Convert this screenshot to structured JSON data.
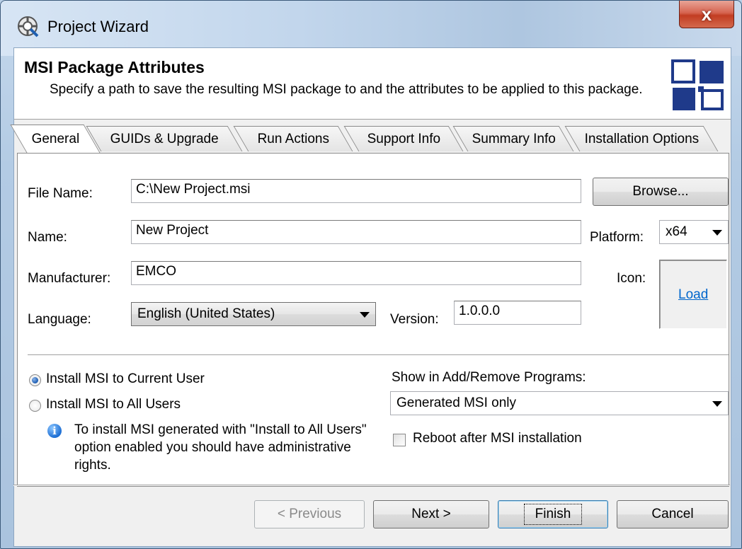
{
  "window": {
    "title": "Project Wizard",
    "close_label": "x"
  },
  "header": {
    "title": "MSI Package Attributes",
    "description": "Specify a path to save the resulting MSI package to and the attributes to be applied to this package."
  },
  "tabs": [
    {
      "label": "General",
      "active": true
    },
    {
      "label": "GUIDs & Upgrade",
      "active": false
    },
    {
      "label": "Run Actions",
      "active": false
    },
    {
      "label": "Support Info",
      "active": false
    },
    {
      "label": "Summary Info",
      "active": false
    },
    {
      "label": "Installation Options",
      "active": false
    }
  ],
  "general": {
    "file_name": {
      "label": "File Name:",
      "value": "C:\\New Project.msi"
    },
    "browse_label": "Browse...",
    "name": {
      "label": "Name:",
      "value": "New Project"
    },
    "platform": {
      "label": "Platform:",
      "value": "x64"
    },
    "manufacturer": {
      "label": "Manufacturer:",
      "value": "EMCO"
    },
    "icon": {
      "label": "Icon:",
      "link": "Load"
    },
    "language": {
      "label": "Language:",
      "value": "English (United States)"
    },
    "version": {
      "label": "Version:",
      "value": "1.0.0.0"
    },
    "install_scope": {
      "current_user": "Install MSI to Current User",
      "all_users": "Install MSI to All Users",
      "selected": "current_user",
      "note": "To install MSI generated with \"Install to All Users\" option enabled you should have administrative rights."
    },
    "add_remove": {
      "label": "Show in Add/Remove Programs:",
      "value": "Generated MSI only"
    },
    "reboot": {
      "label": "Reboot after MSI installation",
      "checked": false
    }
  },
  "footer": {
    "previous": "< Previous",
    "next": "Next >",
    "finish": "Finish",
    "cancel": "Cancel"
  },
  "colors": {
    "link": "#0066cc",
    "close_button": "#c23d22",
    "logo": "#1f3a8a"
  }
}
